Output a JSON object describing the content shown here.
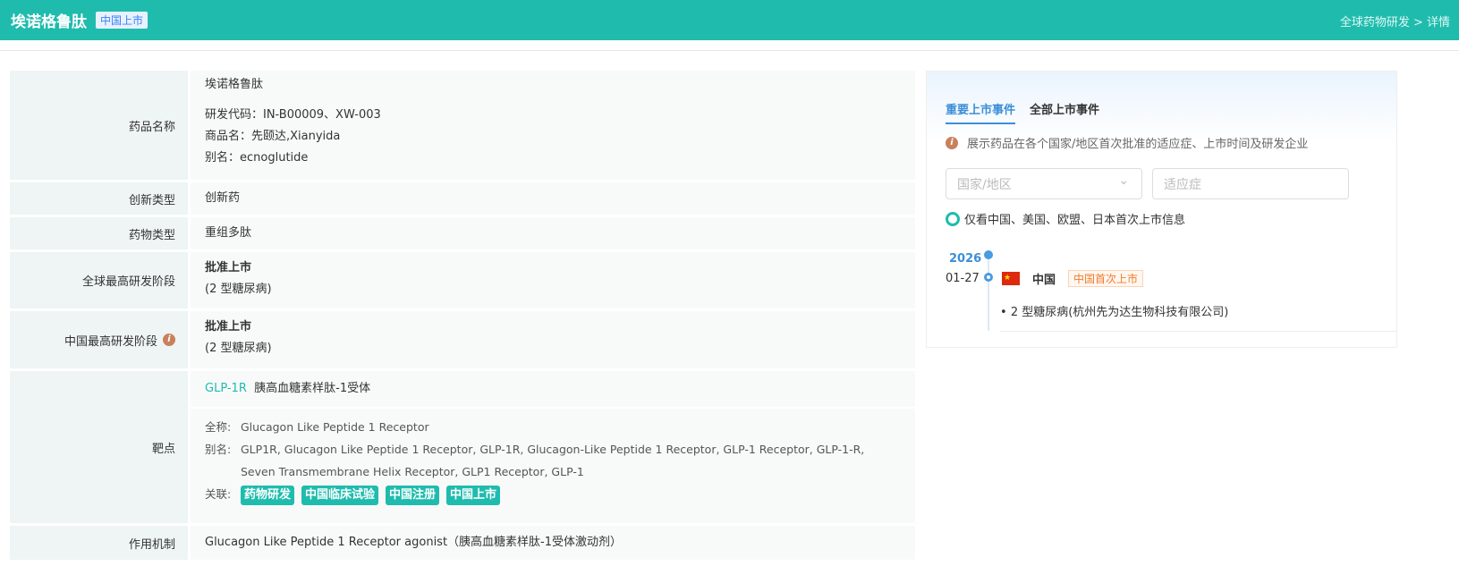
{
  "header": {
    "title": "埃诺格鲁肽",
    "badge": "中国上市",
    "breadcrumb": "全球药物研发 > 详情"
  },
  "rows": {
    "name_label": "药品名称",
    "name": "埃诺格鲁肽",
    "code": "研发代码：IN-B00009、XW-003",
    "trade": "商品名：先颐达,Xianyida",
    "alias": "别名：ecnoglutide",
    "innov_label": "创新类型",
    "innov": "创新药",
    "type_label": "药物类型",
    "type": "重组多肽",
    "global_label": "全球最高研发阶段",
    "global_stage": "批准上市",
    "global_ind": "(2 型糖尿病)",
    "china_label": "中国最高研发阶段",
    "china_stage": "批准上市",
    "china_ind": "(2 型糖尿病)",
    "target_label": "靶点",
    "target_code": "GLP-1R",
    "target_cn": "胰高血糖素样肽-1受体",
    "full_label": "全称:",
    "full": "Glucagon Like Peptide 1 Receptor",
    "alias_label": "别名:",
    "aliases": "GLP1R, Glucagon Like Peptide 1 Receptor, GLP-1R, Glucagon-Like Peptide 1 Receptor, GLP-1 Receptor, GLP-1-R, Seven Transmembrane Helix Receptor, GLP1 Receptor, GLP-1",
    "rel_label": "关联:",
    "tags": [
      "药物研发",
      "中国临床试验",
      "中国注册",
      "中国上市"
    ],
    "mech_label": "作用机制",
    "mech": "Glucagon Like Peptide 1 Receptor agonist（胰高血糖素样肽-1受体激动剂）"
  },
  "panel": {
    "tabs": [
      "重要上市事件",
      "全部上市事件"
    ],
    "note": "展示药品在各个国家/地区首次批准的适应症、上市时间及研发企业",
    "country_placeholder": "国家/地区",
    "indication_placeholder": "适应症",
    "filter": "仅看中国、美国、欧盟、日本首次上市信息",
    "year": "2026",
    "date": "01-27",
    "country": "中国",
    "event_tag": "中国首次上市",
    "detail": "2 型糖尿病(杭州先为达生物科技有限公司)"
  }
}
